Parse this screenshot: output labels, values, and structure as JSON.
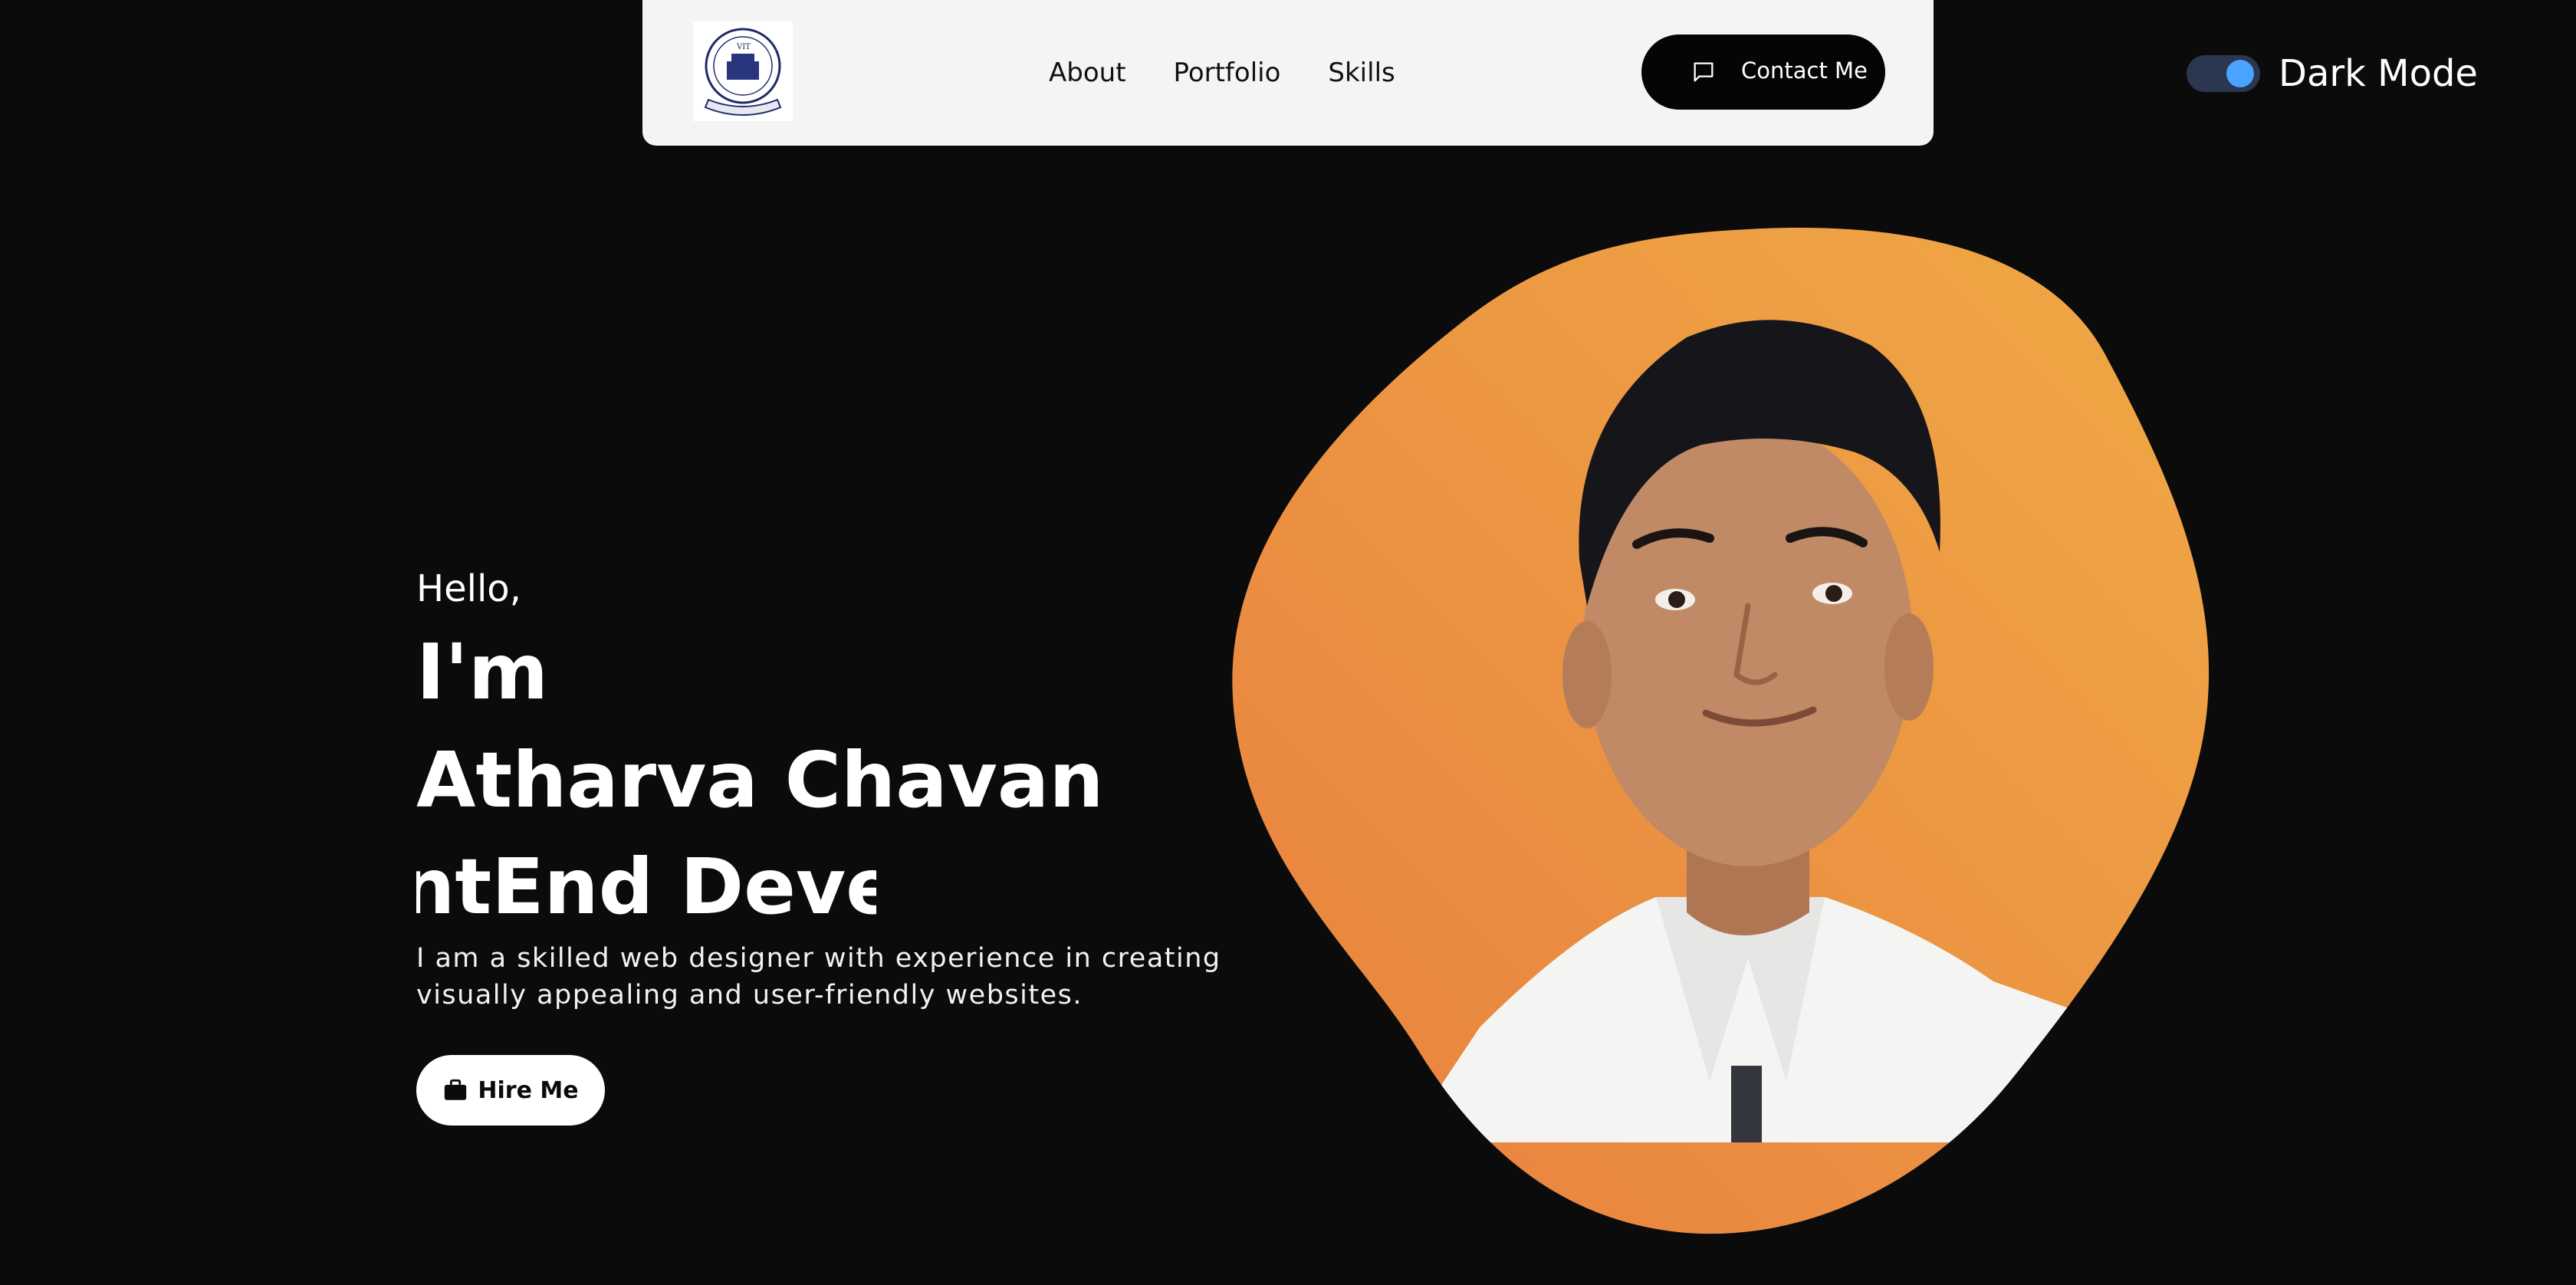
{
  "nav": {
    "logo_name": "vit-logo",
    "links": [
      {
        "label": "About"
      },
      {
        "label": "Portfolio"
      },
      {
        "label": "Skills"
      }
    ],
    "contact_label": "Contact Me",
    "contact_icon": "chat-icon"
  },
  "theme": {
    "label": "Dark Mode",
    "enabled": true,
    "accent": "#4aa3ff"
  },
  "hero": {
    "greeting": "Hello,",
    "im": "I'm",
    "name": "Atharva Chavan",
    "role_visible": "ntEnd Devel",
    "intro": "I am a skilled web designer with experience in creating visually appealing and user-friendly websites.",
    "hire_label": "Hire Me",
    "hire_icon": "briefcase-icon"
  },
  "colors": {
    "background": "#0b0b0b",
    "navbar": "#f4f4f4",
    "blob_light": "#efa445",
    "blob_dark": "#e9843f",
    "button_dark": "#050505"
  }
}
